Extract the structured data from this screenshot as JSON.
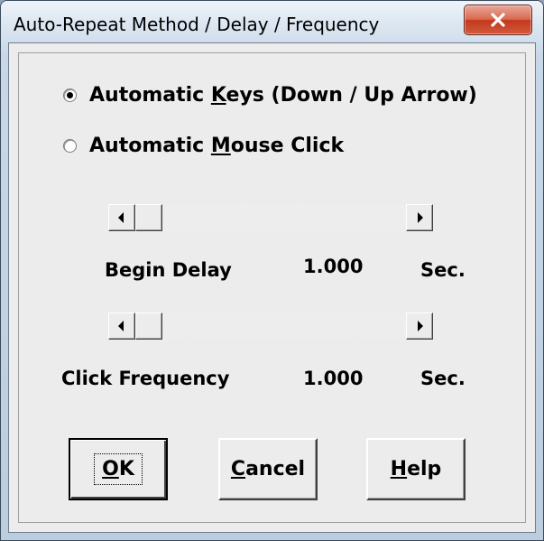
{
  "window": {
    "title": "Auto-Repeat Method / Delay / Frequency"
  },
  "titlebar_icons": {
    "close": "close-icon"
  },
  "method": {
    "options": [
      {
        "pre": "Automatic ",
        "mnemonic": "K",
        "post": "eys (Down / Up Arrow)",
        "checked": true
      },
      {
        "pre": "Automatic ",
        "mnemonic": "M",
        "post": "ouse Click",
        "checked": false
      }
    ]
  },
  "begin_delay": {
    "label": "Begin Delay",
    "value": "1.000",
    "unit": "Sec.",
    "slider_fraction": 0.0
  },
  "click_frequency": {
    "label": "Click Frequency",
    "value": "1.000",
    "unit": "Sec.",
    "slider_fraction": 0.0
  },
  "buttons": {
    "ok": {
      "mnemonic": "O",
      "rest": "K"
    },
    "cancel": {
      "mnemonic": "C",
      "rest": "ancel"
    },
    "help": {
      "mnemonic": "H",
      "rest": "elp"
    }
  },
  "colors": {
    "dialog_face": "#ececec",
    "close_button": "#c3391d"
  }
}
